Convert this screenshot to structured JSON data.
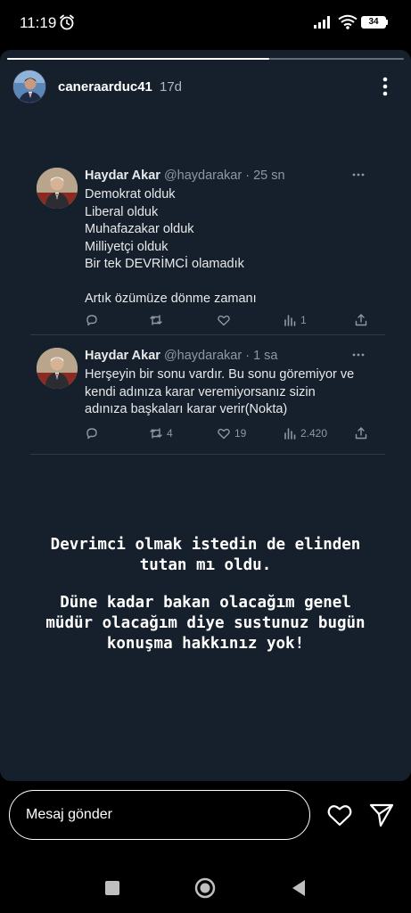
{
  "status_bar": {
    "time": "11:19",
    "battery": "34"
  },
  "story": {
    "progress": 0.66,
    "username": "caneraarduc41",
    "time_ago": "17d",
    "caption_lines": [
      "Devrimci olmak istedin de elinden",
      "tutan mı oldu."
    ],
    "caption2_lines": [
      "Düne kadar bakan olacağım genel",
      "müdür olacağım diye sustunuz bugün",
      "konuşma hakkınız yok!"
    ]
  },
  "tweets": [
    {
      "name": "Haydar Akar",
      "handle": "@haydarakar · 25 sn",
      "lines": [
        "Demokrat olduk",
        "Liberal olduk",
        "Muhafazakar olduk",
        "Milliyetçi olduk",
        "Bir tek DEVRİMCİ  olamadık",
        "",
        "Artık özümüze dönme zamanı"
      ],
      "reply_count": "",
      "retweet_count": "",
      "like_count": "",
      "view_count": "1"
    },
    {
      "name": "Haydar Akar",
      "handle": "@haydarakar · 1 sa",
      "lines": [
        "Herşeyin bir sonu vardır. Bu sonu göremiyor ve",
        "kendi adınıza karar veremiyorsanız sizin",
        "adınıza başkaları karar verir(Nokta)"
      ],
      "reply_count": "",
      "retweet_count": "4",
      "like_count": "19",
      "view_count": "2.420"
    }
  ],
  "bottom_bar": {
    "message_placeholder": "Mesaj gönder"
  },
  "icons": {
    "alarm": "alarm-clock-icon",
    "signal": "cell-signal-icon",
    "wifi": "wifi-icon",
    "more": "more-vertical-icon",
    "heart": "heart-icon",
    "send": "send-icon"
  },
  "colors": {
    "story_background": "#16202c",
    "tweet_text": "#e7e9ea",
    "tweet_secondary": "#8b98a5"
  }
}
